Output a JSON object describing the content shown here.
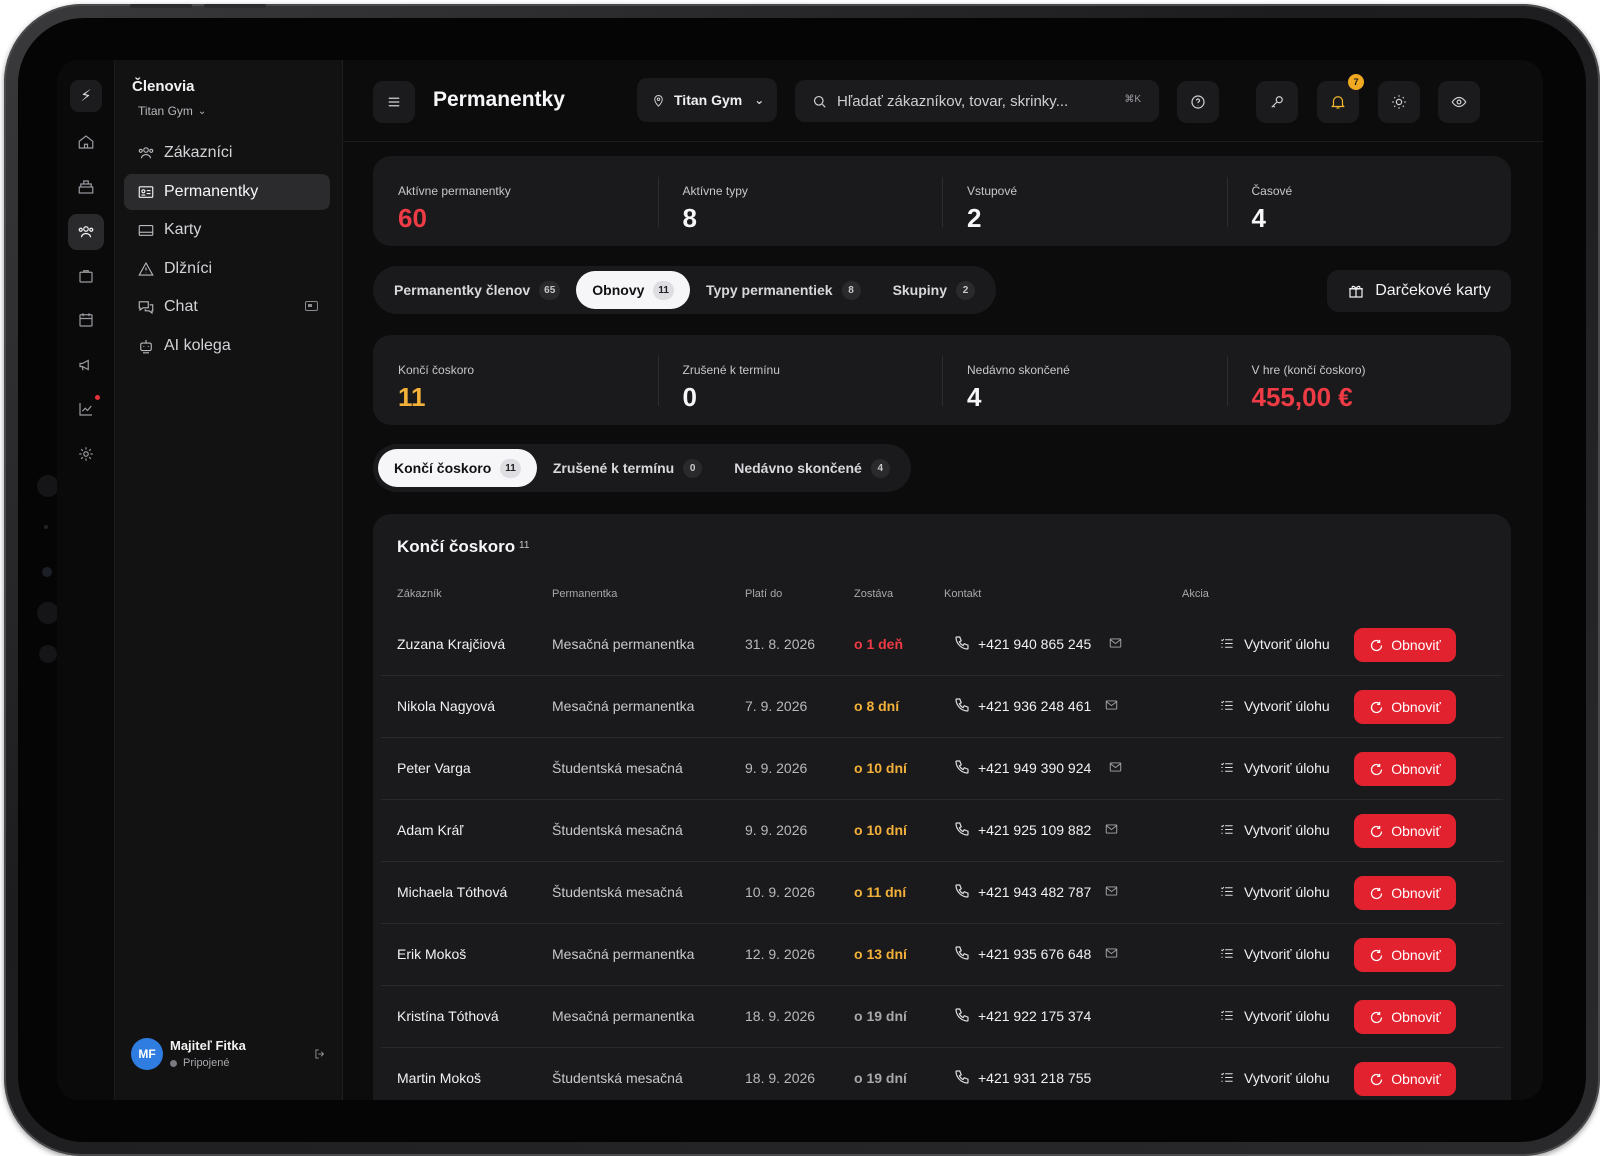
{
  "colors": {
    "accent_red": "#e2232f",
    "warning_amber": "#f4b13a",
    "avatar_blue": "#2f7de1"
  },
  "sidebar": {
    "title": "Členovia",
    "location": "Titan Gym",
    "items": [
      {
        "label": "Zákazníci",
        "icon": "users-icon"
      },
      {
        "label": "Permanentky",
        "icon": "id-card-icon",
        "active": true
      },
      {
        "label": "Karty",
        "icon": "card-icon"
      },
      {
        "label": "Dlžníci",
        "icon": "warning-icon"
      },
      {
        "label": "Chat",
        "icon": "chat-icon"
      },
      {
        "label": "AI kolega",
        "icon": "robot-icon"
      }
    ],
    "user": {
      "initials": "MF",
      "name": "Majiteľ Fitka",
      "status": "Pripojené"
    }
  },
  "header": {
    "title": "Permanentky",
    "location": "Titan Gym",
    "search_placeholder": "Hľadať zákazníkov, tovar, skrinky...",
    "shortcut": "⌘K",
    "notification_count": "7"
  },
  "stats_top": [
    {
      "label": "Aktívne permanentky",
      "value": "60"
    },
    {
      "label": "Aktívne typy",
      "value": "8"
    },
    {
      "label": "Vstupové",
      "value": "2"
    },
    {
      "label": "Časové",
      "value": "4"
    }
  ],
  "main_tabs": [
    {
      "label": "Permanentky členov",
      "count": "65"
    },
    {
      "label": "Obnovy",
      "count": "11",
      "active": true
    },
    {
      "label": "Typy permanentiek",
      "count": "8"
    },
    {
      "label": "Skupiny",
      "count": "2"
    }
  ],
  "gift_button": "Darčekové karty",
  "stats_renewals": [
    {
      "label": "Končí čoskoro",
      "value": "11"
    },
    {
      "label": "Zrušené k termínu",
      "value": "0"
    },
    {
      "label": "Nedávno skončené",
      "value": "4"
    },
    {
      "label": "V hre (končí čoskoro)",
      "value": "455,00 €"
    }
  ],
  "sub_tabs": [
    {
      "label": "Končí čoskoro",
      "count": "11",
      "active": true
    },
    {
      "label": "Zrušené k termínu",
      "count": "0"
    },
    {
      "label": "Nedávno skončené",
      "count": "4"
    }
  ],
  "table": {
    "title": "Končí čoskoro",
    "count": "11",
    "headers": [
      "Zákazník",
      "Permanentka",
      "Platí do",
      "Zostáva",
      "Kontakt",
      "Akcia"
    ],
    "task_label": "Vytvoriť úlohu",
    "renew_label": "Obnoviť",
    "rows": [
      {
        "name": "Zuzana Krajčiová",
        "plan": "Mesačná permanentka",
        "valid_until": "31. 8. 2026",
        "remaining": "o 1 deň",
        "level": "red",
        "phone": "+421 940 865 245",
        "email": true
      },
      {
        "name": "Nikola Nagyová",
        "plan": "Mesačná permanentka",
        "valid_until": "7. 9. 2026",
        "remaining": "o 8 dní",
        "level": "amber",
        "phone": "+421 936 248 461",
        "email": true
      },
      {
        "name": "Peter Varga",
        "plan": "Študentská mesačná",
        "valid_until": "9. 9. 2026",
        "remaining": "o 10 dní",
        "level": "amber",
        "phone": "+421 949 390 924",
        "email": true
      },
      {
        "name": "Adam Kráľ",
        "plan": "Študentská mesačná",
        "valid_until": "9. 9. 2026",
        "remaining": "o 10 dní",
        "level": "amber",
        "phone": "+421 925 109 882",
        "email": true
      },
      {
        "name": "Michaela Tóthová",
        "plan": "Študentská mesačná",
        "valid_until": "10. 9. 2026",
        "remaining": "o 11 dní",
        "level": "amber",
        "phone": "+421 943 482 787",
        "email": true
      },
      {
        "name": "Erik Mokoš",
        "plan": "Mesačná permanentka",
        "valid_until": "12. 9. 2026",
        "remaining": "o 13 dní",
        "level": "amber",
        "phone": "+421 935 676 648",
        "email": true
      },
      {
        "name": "Kristína Tóthová",
        "plan": "Mesačná permanentka",
        "valid_until": "18. 9. 2026",
        "remaining": "o 19 dní",
        "level": "grey",
        "phone": "+421 922 175 374",
        "email": false
      },
      {
        "name": "Martin Mokoš",
        "plan": "Študentská mesačná",
        "valid_until": "18. 9. 2026",
        "remaining": "o 19 dní",
        "level": "grey",
        "phone": "+421 931 218 755",
        "email": false
      }
    ]
  }
}
